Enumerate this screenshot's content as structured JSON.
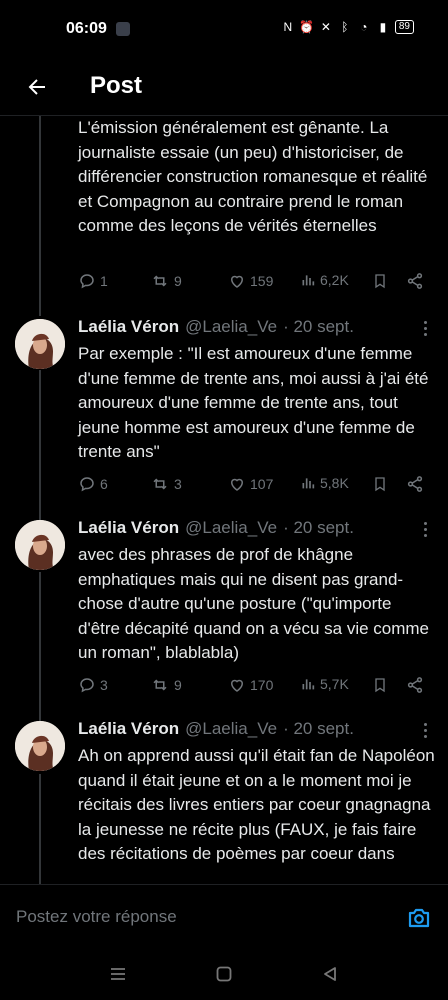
{
  "status_bar": {
    "time": "06:09",
    "battery": "89"
  },
  "header": {
    "title": "Post"
  },
  "tweets": [
    {
      "text": "L'émission  généralement est gênante. La journaliste essaie (un peu)  d'historiciser, de différencier construction romanesque et réalité et Compagnon au contraire prend le roman comme des leçons de vérités  éternelles",
      "replies": "1",
      "retweets": "9",
      "likes": "159",
      "views": "6,2K"
    },
    {
      "name": "Laélia Véron",
      "handle": "@Laelia_Ve",
      "date": "· 20 sept.",
      "text": "Par exemple : \"Il est amoureux d'une femme d'une femme de trente ans, moi aussi  à j'ai été amoureux d'une femme de trente ans, tout jeune homme est amoureux d'une femme de trente ans\"",
      "replies": "6",
      "retweets": "3",
      "likes": "107",
      "views": "5,8K"
    },
    {
      "name": "Laélia Véron",
      "handle": "@Laelia_Ve",
      "date": "· 20 sept.",
      "text": "avec des phrases de prof de khâgne emphatiques mais qui ne disent pas grand-chose d'autre qu'une  posture (\"qu'importe d'être décapité quand on a vécu sa vie comme un  roman\", blablabla)",
      "replies": "3",
      "retweets": "9",
      "likes": "170",
      "views": "5,7K"
    },
    {
      "name": "Laélia Véron",
      "handle": "@Laelia_Ve",
      "date": "· 20 sept.",
      "text": "Ah on apprend aussi qu'il était fan de Napoléon quand il était jeune et on a le moment moi je récitais des livres entiers par coeur gnagnagna la jeunesse ne récite plus (FAUX, je fais faire des récitations de poèmes par coeur dans"
    }
  ],
  "reply_bar": {
    "placeholder": "Postez votre réponse"
  },
  "colors": {
    "accent": "#1d9bf0",
    "muted": "#71767b",
    "text": "#e7e9ea",
    "background": "#000000"
  }
}
